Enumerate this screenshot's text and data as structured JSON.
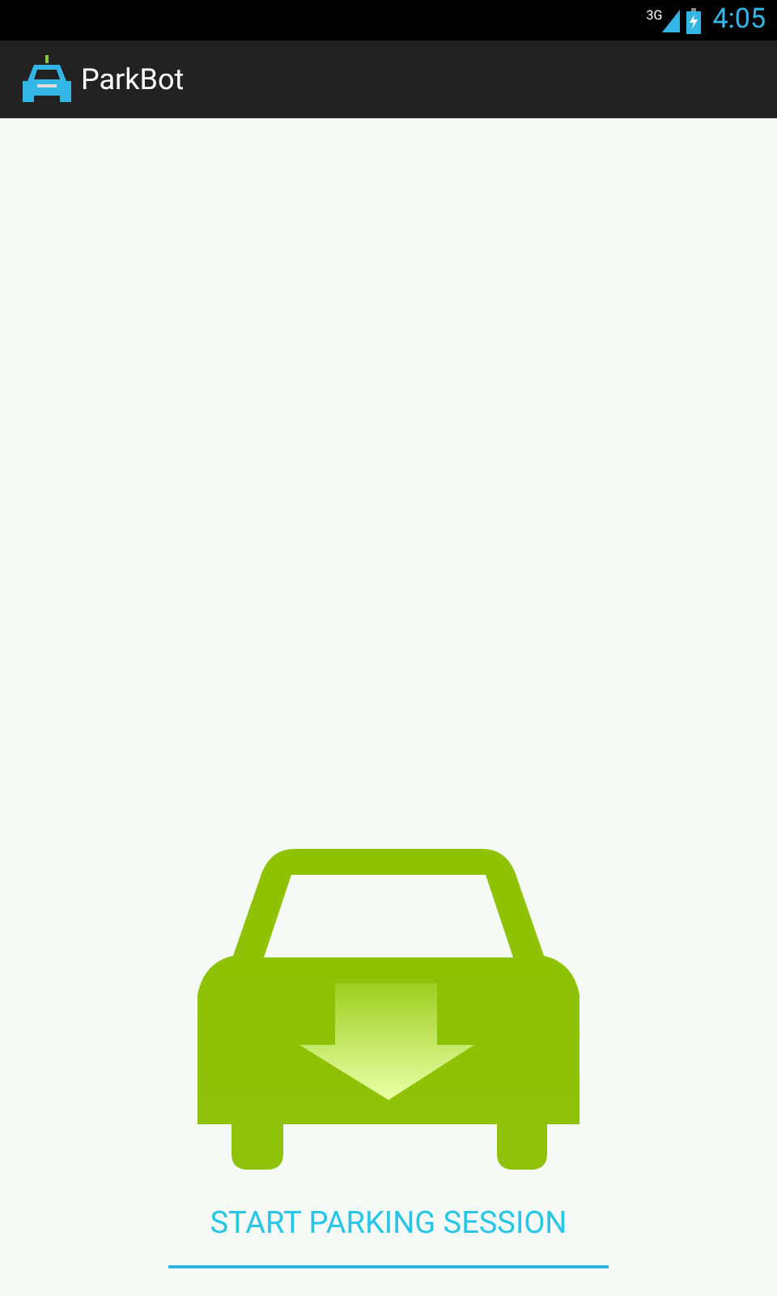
{
  "status_bar": {
    "network": "3G",
    "time": "4:05"
  },
  "app_bar": {
    "title": "ParkBot"
  },
  "start_button": {
    "label": "START PARKING SESSION"
  }
}
